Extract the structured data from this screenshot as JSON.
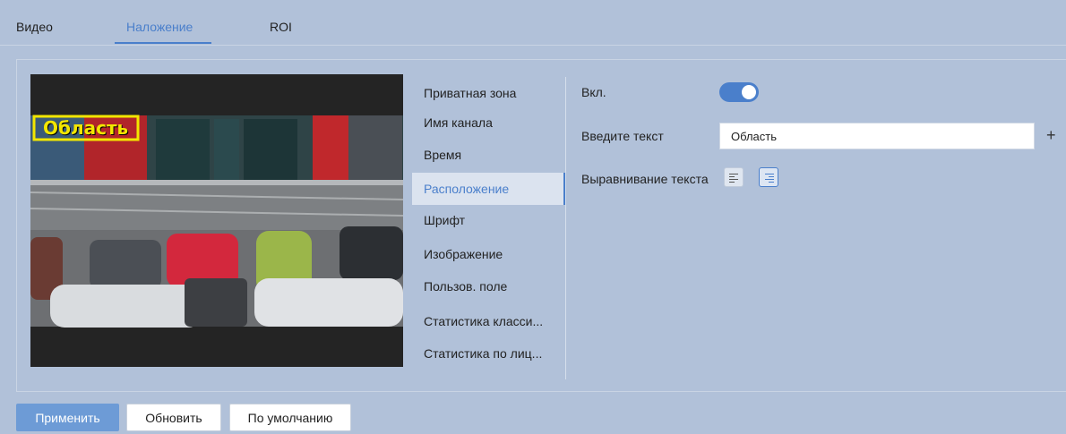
{
  "tabs": [
    {
      "label": "Видео",
      "active": false
    },
    {
      "label": "Наложение",
      "active": true
    },
    {
      "label": "ROI",
      "active": false
    }
  ],
  "preview": {
    "overlay_text": "Область"
  },
  "menu": {
    "items": [
      {
        "label": "Приватная зона"
      },
      {
        "label": "Имя канала"
      },
      {
        "label": "Время"
      },
      {
        "label": "Расположение",
        "active": true
      },
      {
        "label": "Шрифт"
      },
      {
        "label": "Изображение"
      },
      {
        "label": "Пользов. поле"
      },
      {
        "label": "Статистика класси..."
      },
      {
        "label": "Статистика по лиц..."
      }
    ]
  },
  "settings": {
    "enable_label": "Вкл.",
    "enable_value": true,
    "text_label": "Введите текст",
    "text_value": "Область",
    "alignment_label": "Выравнивание текста",
    "alignment_selected": "right"
  },
  "footer": {
    "apply_label": "Применить",
    "refresh_label": "Обновить",
    "default_label": "По умолчанию"
  },
  "colors": {
    "accent": "#4a7fcb",
    "background": "#b1c1d9",
    "primary_button": "#6d9bd6",
    "overlay_box": "#f2e600"
  }
}
